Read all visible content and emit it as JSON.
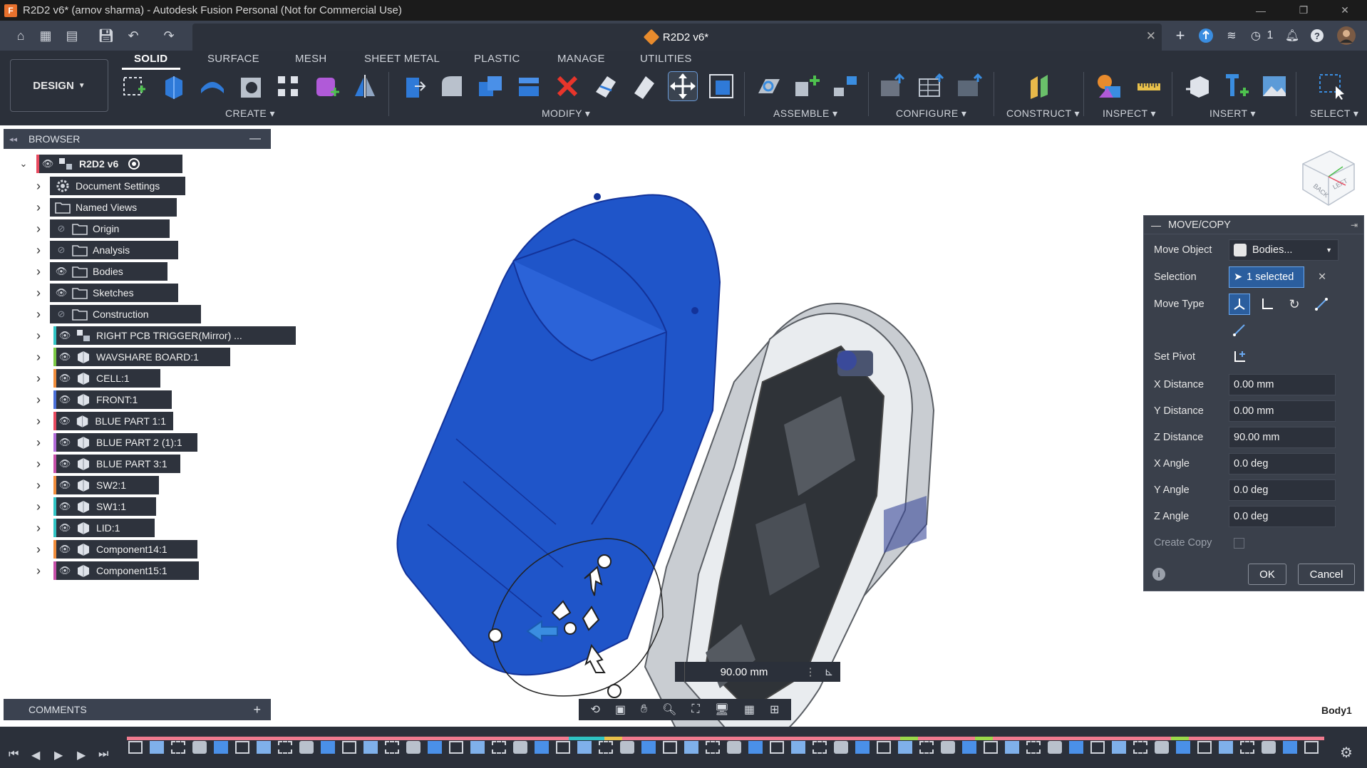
{
  "window": {
    "title": "R2D2 v6* (arnov sharma) - Autodesk Fusion Personal (Not for Commercial Use)",
    "logo_letter": "F",
    "minimize": "—",
    "restore": "❐",
    "close": "✕"
  },
  "document_tab": {
    "name": "R2D2 v6*",
    "close": "✕"
  },
  "header_right": {
    "new_tab": "+",
    "job_count": "1"
  },
  "toolbar": {
    "workspace_button": "DESIGN",
    "tabs": [
      "SOLID",
      "SURFACE",
      "MESH",
      "SHEET METAL",
      "PLASTIC",
      "MANAGE",
      "UTILITIES"
    ],
    "groups": [
      "CREATE",
      "MODIFY",
      "ASSEMBLE",
      "CONFIGURE",
      "CONSTRUCT",
      "INSPECT",
      "INSERT",
      "SELECT"
    ]
  },
  "browser": {
    "title": "BROWSER",
    "root": "R2D2 v6",
    "items": [
      {
        "label": "Document Settings",
        "icon": "gear-icon",
        "eye": "none",
        "color": ""
      },
      {
        "label": "Named Views",
        "icon": "folder-icon",
        "eye": "none",
        "color": ""
      },
      {
        "label": "Origin",
        "icon": "folder-icon",
        "eye": "hidden",
        "color": ""
      },
      {
        "label": "Analysis",
        "icon": "folder-icon",
        "eye": "hidden",
        "color": ""
      },
      {
        "label": "Bodies",
        "icon": "folder-icon",
        "eye": "visible",
        "color": ""
      },
      {
        "label": "Sketches",
        "icon": "folder-icon",
        "eye": "visible",
        "color": ""
      },
      {
        "label": "Construction",
        "icon": "folder-icon",
        "eye": "hidden",
        "color": ""
      },
      {
        "label": "RIGHT PCB TRIGGER(Mirror) ...",
        "icon": "assembly-icon",
        "eye": "visible",
        "color": "#2fc3c3"
      },
      {
        "label": "WAVSHARE BOARD:1",
        "icon": "component-icon",
        "eye": "visible",
        "color": "#7ac943"
      },
      {
        "label": "CELL:1",
        "icon": "component-icon",
        "eye": "visible",
        "color": "#f08c3a"
      },
      {
        "label": "FRONT:1",
        "icon": "component-icon",
        "eye": "visible",
        "color": "#4a6fd8"
      },
      {
        "label": "BLUE PART 1:1",
        "icon": "component-icon",
        "eye": "visible",
        "color": "#e84a5f"
      },
      {
        "label": "BLUE PART 2 (1):1",
        "icon": "component-icon",
        "eye": "visible",
        "color": "#b06ad8"
      },
      {
        "label": "BLUE PART 3:1",
        "icon": "component-icon",
        "eye": "visible",
        "color": "#c64fa8"
      },
      {
        "label": "SW2:1",
        "icon": "component-icon",
        "eye": "visible",
        "color": "#f08c3a"
      },
      {
        "label": "SW1:1",
        "icon": "component-icon",
        "eye": "visible",
        "color": "#2fc3c3"
      },
      {
        "label": "LID:1",
        "icon": "component-icon",
        "eye": "visible",
        "color": "#2fc3c3"
      },
      {
        "label": "Component14:1",
        "icon": "component-icon",
        "eye": "visible",
        "color": "#f08c3a"
      },
      {
        "label": "Component15:1",
        "icon": "component-icon",
        "eye": "visible",
        "color": "#c64fa8"
      }
    ]
  },
  "comments": {
    "title": "COMMENTS",
    "add": "+"
  },
  "dialog": {
    "title": "MOVE/COPY",
    "move_object_label": "Move Object",
    "move_object_value": "Bodies...",
    "selection_label": "Selection",
    "selection_value": "1 selected",
    "move_type_label": "Move Type",
    "set_pivot_label": "Set Pivot",
    "fields": [
      {
        "label": "X Distance",
        "value": "0.00 mm"
      },
      {
        "label": "Y Distance",
        "value": "0.00 mm"
      },
      {
        "label": "Z Distance",
        "value": "90.00 mm"
      },
      {
        "label": "X Angle",
        "value": "0.0 deg"
      },
      {
        "label": "Y Angle",
        "value": "0.0 deg"
      },
      {
        "label": "Z Angle",
        "value": "0.0 deg"
      }
    ],
    "create_copy_label": "Create Copy",
    "ok": "OK",
    "cancel": "Cancel"
  },
  "viewport": {
    "distance_readout": "90.00 mm",
    "selected_body": "Body1",
    "viewcube_faces": [
      "BACK",
      "LEFT"
    ]
  },
  "colors": {
    "accent_blue": "#1f55c9",
    "toolbar_bg": "#2b303a",
    "panel_bg": "#3a404b"
  }
}
